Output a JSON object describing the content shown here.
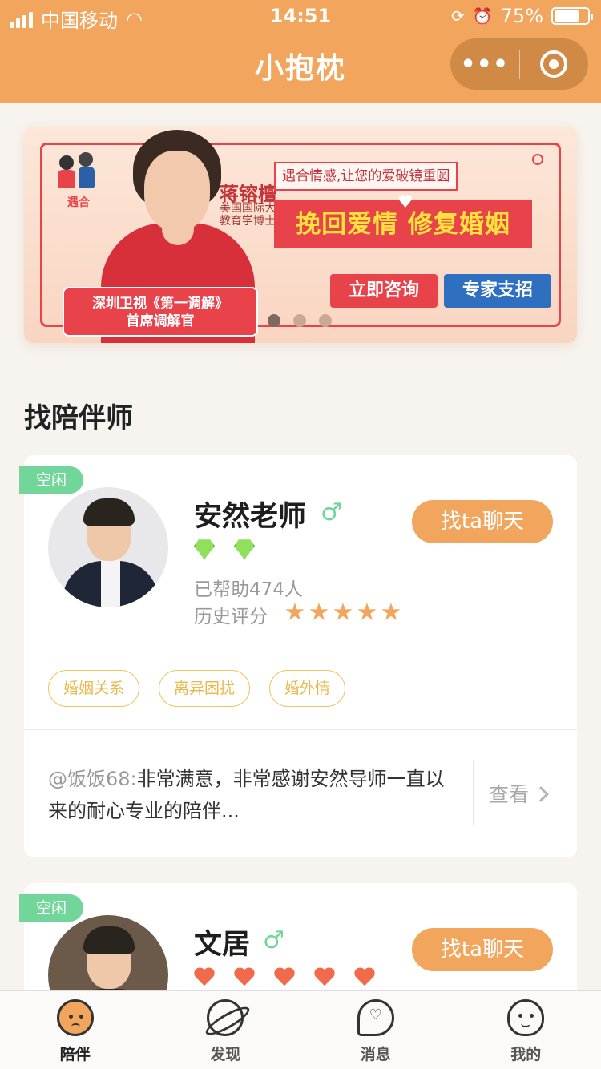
{
  "status_bar": {
    "carrier": "中国移动",
    "time": "14:51",
    "battery_percent": "75%",
    "battery_level": 0.75
  },
  "nav": {
    "title": "小抱枕",
    "more_label": "•••"
  },
  "banner": {
    "logo_text": "遇合",
    "name": "蒋镕檀",
    "credentials": [
      "美国国际大学",
      "教育学博士"
    ],
    "slogan": "遇合情感,让您的爱破镜重圆",
    "headline": "挽回爱情 修复婚姻",
    "consult_button": "立即咨询",
    "expert_button": "专家支招",
    "badge_line1": "深圳卫视《第一调解》",
    "badge_line2": "首席调解官",
    "pagination_total": 3,
    "pagination_active": 1
  },
  "section": {
    "title": "找陪伴师"
  },
  "teachers": [
    {
      "status": "空闲",
      "name": "安然老师",
      "gender_icon": "♂",
      "level_icon": "gem-icon",
      "level_count": 2,
      "helped": "已帮助474人",
      "rating_label": "历史评分",
      "rating_stars": 5,
      "chat_button": "找ta聊天",
      "tags": [
        "婚姻关系",
        "离异困扰",
        "婚外情"
      ],
      "review_user": "@饭饭68:",
      "review_text": "非常满意，非常感谢安然导师一直以来的耐心专业的陪伴...",
      "view_label": "查看"
    },
    {
      "status": "空闲",
      "name": "文居",
      "gender_icon": "♂",
      "level_icon": "heart-icon",
      "level_count": 5,
      "chat_button": "找ta聊天"
    }
  ],
  "tabbar": {
    "items": [
      {
        "label": "陪伴",
        "icon": "face-icon",
        "active": true
      },
      {
        "label": "发现",
        "icon": "planet-icon",
        "active": false
      },
      {
        "label": "消息",
        "icon": "message-heart-icon",
        "active": false
      },
      {
        "label": "我的",
        "icon": "smile-face-icon",
        "active": false
      }
    ]
  },
  "colors": {
    "brand": "#f2a55c",
    "idle": "#72d59a",
    "banner_red": "#e8424a",
    "tag_gold": "#e9b84a"
  }
}
